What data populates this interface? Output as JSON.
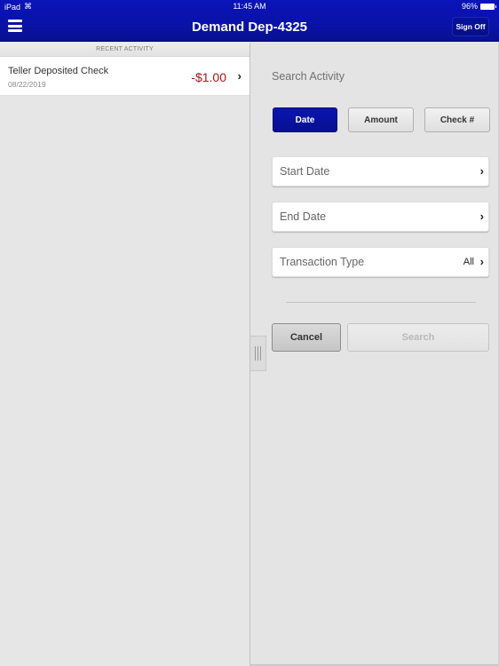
{
  "status_bar": {
    "device": "iPad",
    "wifi_icon": "wifi-icon",
    "time": "11:45 AM",
    "battery": "96%",
    "battery_icon": "battery-icon"
  },
  "nav": {
    "menu_icon": "hamburger-menu-icon",
    "title": "Demand Dep-4325",
    "sign_off_label": "Sign Off"
  },
  "recent_activity": {
    "header": "RECENT ACTIVITY",
    "items": [
      {
        "title": "Teller Deposited Check",
        "date": "08/22/2019",
        "amount": "-$1.00",
        "chevron": "›"
      }
    ]
  },
  "search": {
    "title": "Search Activity",
    "filter_tabs": [
      {
        "label": "Date",
        "selected": true
      },
      {
        "label": "Amount",
        "selected": false
      },
      {
        "label": "Check #",
        "selected": false
      }
    ],
    "fields": [
      {
        "label": "Start Date",
        "value": "",
        "chevron": "›"
      },
      {
        "label": "End Date",
        "value": "",
        "chevron": "›"
      },
      {
        "label": "Transaction Type",
        "value": "All",
        "chevron": "›"
      }
    ],
    "cancel_label": "Cancel",
    "search_label": "Search"
  },
  "colors": {
    "brand_blue": "#0a14b8",
    "negative_amount": "#a3141a"
  }
}
